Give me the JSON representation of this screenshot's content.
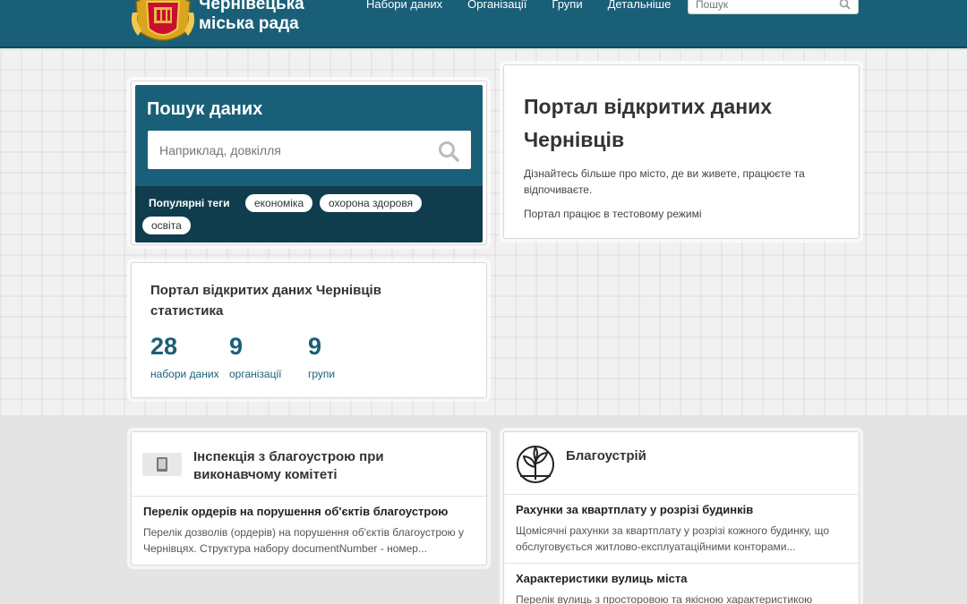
{
  "header": {
    "logo_line1": "Чернівецька",
    "logo_line2": "міська рада",
    "nav": [
      "Набори даних",
      "Організації",
      "Групи",
      "Детальніше"
    ],
    "search_placeholder": "Пошук",
    "bg_color": "#1a5f78"
  },
  "search": {
    "title": "Пошук даних",
    "placeholder": "Наприклад, довкілля",
    "popular_tags_label": "Популярні теги",
    "tags": [
      "економіка",
      "охорона здоровя",
      "освіта"
    ]
  },
  "intro": {
    "title": "Портал відкритих даних Чернівців",
    "description": "Дізнайтесь більше про місто, де ви живете, працюєте та відпочиваєте.",
    "note": "Портал працює в тестовому режимі"
  },
  "stats": {
    "title": "Портал відкритих даних Чернівців статистика",
    "items": [
      {
        "value": "28",
        "label": "набори даних"
      },
      {
        "value": "9",
        "label": "організації"
      },
      {
        "value": "9",
        "label": "групи"
      }
    ]
  },
  "org_module": {
    "title": "Інспекція з благоустрою при виконавчому комітеті",
    "icon": "tablet-icon",
    "datasets": [
      {
        "title": "Перелік ордерів на порушення об'єктів благоустрою",
        "desc": "Перелік дозволів (ордерів) на порушення об'єктів благоустрою у Чернівцях. Структура набору documentNumber - номер..."
      }
    ]
  },
  "group_module": {
    "title": "Благоустрій",
    "icon": "plant-icon",
    "datasets": [
      {
        "title": "Рахунки за квартплату у розрізі будинків",
        "desc": "Щомісячні рахунки за квартплату у розрізі кожного будинку, що обслуговується житлово-експлуатаційними конторами..."
      },
      {
        "title": "Характеристики вулиць міста",
        "desc": "Перелік вулиць з просторовою та якісною характеристикою"
      }
    ]
  },
  "colors": {
    "accent": "#1a5f78",
    "tags_bar": "#0f3d4e"
  }
}
